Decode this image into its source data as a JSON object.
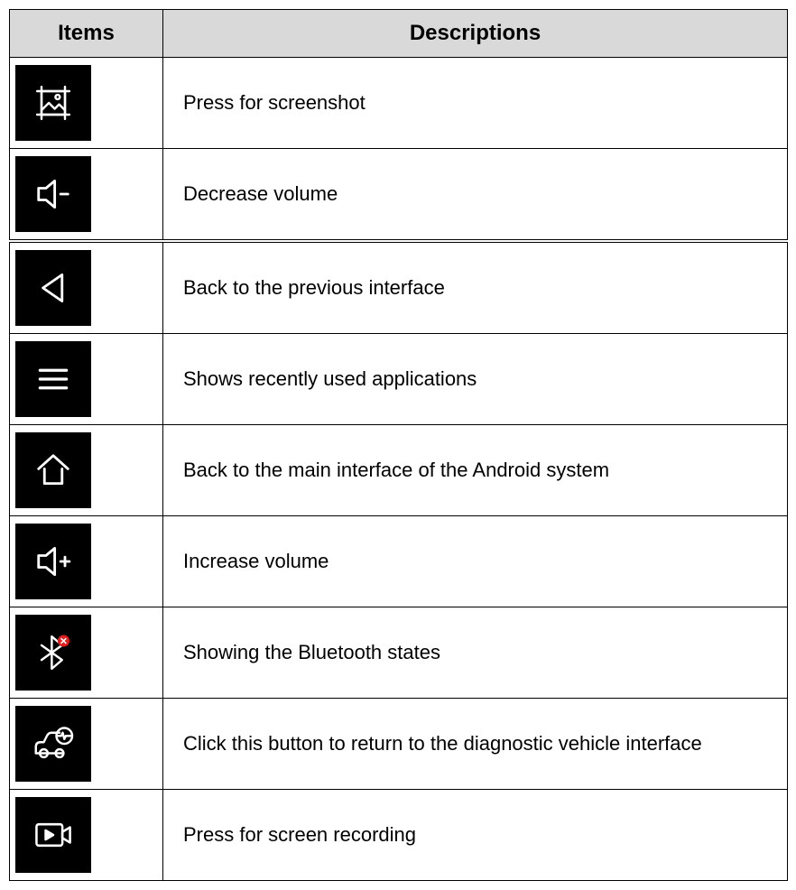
{
  "headers": {
    "items": "Items",
    "descriptions": "Descriptions"
  },
  "rows": [
    {
      "icon": "screenshot-icon",
      "description": "Press for screenshot"
    },
    {
      "icon": "volume-down-icon",
      "description": "Decrease volume"
    },
    {
      "icon": "back-icon",
      "description": "Back to the previous interface"
    },
    {
      "icon": "recent-apps-icon",
      "description": "Shows recently used applications"
    },
    {
      "icon": "home-icon",
      "description": "Back to the main interface of the Android system"
    },
    {
      "icon": "volume-up-icon",
      "description": "Increase volume"
    },
    {
      "icon": "bluetooth-status-icon",
      "description": "Showing the Bluetooth states"
    },
    {
      "icon": "diagnostic-car-icon",
      "description": "Click this button to return to the diagnostic vehicle interface"
    },
    {
      "icon": "screen-record-icon",
      "description": "Press for screen recording"
    }
  ]
}
